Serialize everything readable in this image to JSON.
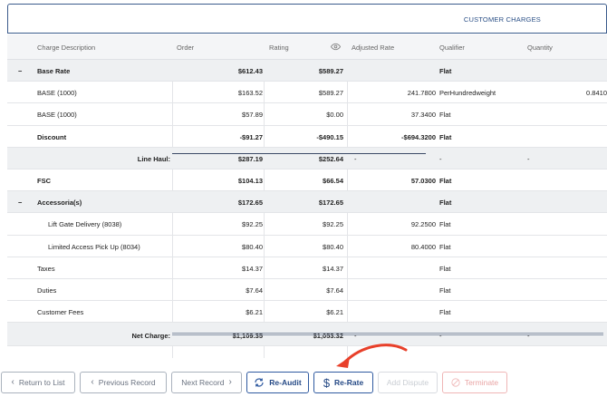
{
  "tab": {
    "title": "CUSTOMER CHARGES"
  },
  "columns": {
    "charge_description": "Charge Description",
    "order": "Order",
    "rating": "Rating",
    "adjusted_rate": "Adjusted Rate",
    "qualifier": "Qualifier",
    "quantity": "Quantity"
  },
  "rows": [
    {
      "toggle": "−",
      "desc": "Base Rate",
      "order": "$612.43",
      "rating": "$589.27",
      "adjusted": "",
      "qualifier": "Flat",
      "quantity": ""
    },
    {
      "desc": "BASE (1000)",
      "order": "$163.52",
      "rating": "$589.27",
      "adjusted": "241.7800",
      "qualifier": "PerHundredweight",
      "quantity": "0.8410"
    },
    {
      "desc": "BASE (1000)",
      "order": "$57.89",
      "rating": "$0.00",
      "adjusted": "37.3400",
      "qualifier": "Flat",
      "quantity": ""
    },
    {
      "desc": "Discount",
      "order": "-$91.27",
      "rating": "-$490.15",
      "adjusted": "-$694.3200",
      "qualifier": "Flat",
      "quantity": ""
    },
    {
      "desc": "Line Haul:",
      "order": "$287.19",
      "rating": "$252.64",
      "adjusted": "-",
      "qualifier": "-",
      "quantity": "-"
    },
    {
      "desc": "FSC",
      "order": "$104.13",
      "rating": "$66.54",
      "adjusted": "57.0300",
      "qualifier": "Flat",
      "quantity": ""
    },
    {
      "toggle": "−",
      "desc": "Accessoria(s)",
      "order": "$172.65",
      "rating": "$172.65",
      "adjusted": "",
      "qualifier": "Flat",
      "quantity": ""
    },
    {
      "desc": "Lift Gate Delivery (8038)",
      "order": "$92.25",
      "rating": "$92.25",
      "adjusted": "92.2500",
      "qualifier": "Flat",
      "quantity": ""
    },
    {
      "desc": "Limited Access Pick Up (8034)",
      "order": "$80.40",
      "rating": "$80.40",
      "adjusted": "80.4000",
      "qualifier": "Flat",
      "quantity": ""
    },
    {
      "desc": "Taxes",
      "order": "$14.37",
      "rating": "$14.37",
      "adjusted": "",
      "qualifier": "Flat",
      "quantity": ""
    },
    {
      "desc": "Duties",
      "order": "$7.64",
      "rating": "$7.64",
      "adjusted": "",
      "qualifier": "Flat",
      "quantity": ""
    },
    {
      "desc": "Customer Fees",
      "order": "$6.21",
      "rating": "$6.21",
      "adjusted": "",
      "qualifier": "Flat",
      "quantity": ""
    },
    {
      "desc": "Net Charge:",
      "order": "$1,109.35",
      "rating": "$1,053.32",
      "adjusted": "-",
      "qualifier": "-",
      "quantity": "-"
    }
  ],
  "footer": {
    "return_label": "Return to List",
    "previous_label": "Previous Record",
    "next_label": "Next Record",
    "reaudit_label": "Re-Audit",
    "rerate_label": "Re-Rate",
    "dispute_label": "Add Dispute",
    "terminate_label": "Terminate"
  },
  "icons": {
    "rating_header": "eye-icon",
    "return": "chevron-left-icon",
    "previous": "chevron-left-icon",
    "next": "chevron-right-icon",
    "reaudit": "refresh-icon",
    "rerate": "dollar-icon",
    "terminate": "cancel-circle-icon",
    "annotation": "red-arrow-icon"
  },
  "colors": {
    "primary": "#2f5aa0",
    "annotation": "#e8402a",
    "danger": "#efb6b6"
  }
}
